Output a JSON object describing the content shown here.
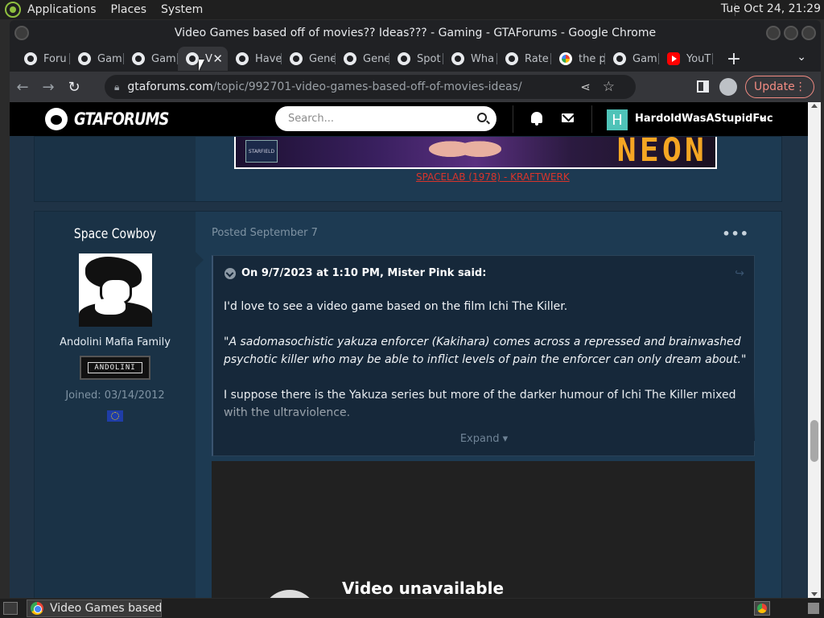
{
  "desktop": {
    "menus": [
      "Applications",
      "Places",
      "System"
    ],
    "clock": "Tue Oct 24, 21:29"
  },
  "window": {
    "title": "Video Games based off of movies?? Ideas??? - Gaming - GTAForums - Google Chrome"
  },
  "tabs": [
    {
      "label": "Foru",
      "icon": "gtaforums-favicon"
    },
    {
      "label": "Gam",
      "icon": "gtaforums-favicon"
    },
    {
      "label": "Gam",
      "icon": "gtaforums-favicon"
    },
    {
      "label": "V",
      "icon": "gtaforums-favicon",
      "active": true
    },
    {
      "label": "Have",
      "icon": "gtaforums-favicon"
    },
    {
      "label": "Gene",
      "icon": "gtaforums-favicon"
    },
    {
      "label": "Gene",
      "icon": "gtaforums-favicon"
    },
    {
      "label": "Spot",
      "icon": "gtaforums-favicon"
    },
    {
      "label": "Wha",
      "icon": "gtaforums-favicon"
    },
    {
      "label": "Rate",
      "icon": "gtaforums-favicon"
    },
    {
      "label": "the p",
      "icon": "google-favicon"
    },
    {
      "label": "Gam",
      "icon": "gtaforums-favicon"
    },
    {
      "label": "YouT",
      "icon": "youtube-favicon"
    }
  ],
  "toolbar": {
    "url_host": "gtaforums.com",
    "url_path": "/topic/992701-video-games-based-off-of-movies-ideas/",
    "update_label": "Update"
  },
  "site": {
    "logo_text": "GTAFORUMS",
    "search_placeholder": "Search...",
    "user_initial": "H",
    "username": "HardoldWasAStupidFuc"
  },
  "prev_post": {
    "banner_badge": "STARFIELD",
    "banner_text": "NEON",
    "link": "SPACELAB (1978) - KRAFTWERK"
  },
  "post": {
    "author": "Space Cowboy",
    "group": "Andolini Mafia Family",
    "rank_label": "ANDOLINI",
    "joined": "Joined: 03/14/2012",
    "date": "Posted September 7",
    "quote": {
      "header": "On 9/7/2023 at 1:10 PM, Mister Pink said:",
      "p1": "I'd love to see a video game based on the film Ichi The Killer.",
      "p2": "\"A sadomasochistic yakuza enforcer (Kakihara) comes across a repressed and brainwashed psychotic killer who may be able to inflict levels of pain the enforcer can only dream about.\"",
      "p3": "I suppose there is the Yakuza series but more of the darker humour of Ichi The Killer mixed with the ultraviolence.",
      "expand": "Expand"
    },
    "video_message": "Video unavailable"
  },
  "taskbar": {
    "task_label": "Video Games based ..."
  },
  "colors": {
    "page_bg": "#1f3346",
    "header_bg": "#000000",
    "accent_link": "#d9342b",
    "update_red": "#f28b82"
  }
}
